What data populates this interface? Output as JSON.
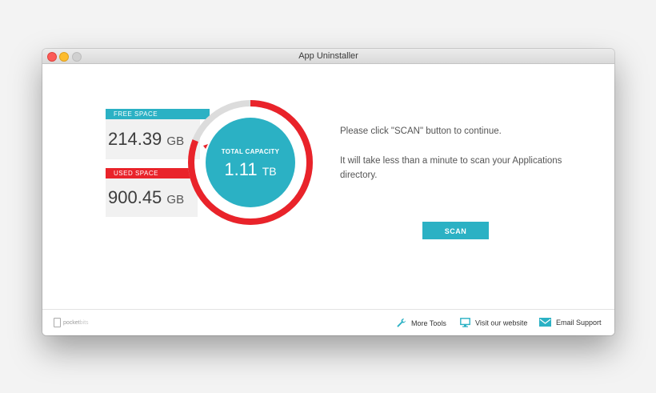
{
  "window": {
    "title": "App Uninstaller"
  },
  "disk": {
    "free_label": "FREE SPACE",
    "free_value": "214.39",
    "free_unit": "GB",
    "used_label": "USED SPACE",
    "used_value": "900.45",
    "used_unit": "GB",
    "capacity_label": "TOTAL CAPACITY",
    "capacity_value": "1.11",
    "capacity_unit": "TB",
    "free_fraction": 0.19,
    "used_fraction": 0.81
  },
  "main": {
    "message_primary": "Please click \"SCAN\" button to continue.",
    "message_secondary": "It will take less than a minute to scan your Applications directory.",
    "scan_label": "SCAN"
  },
  "footer": {
    "brand_part1": "pocket",
    "brand_part2": "bits",
    "more_tools": "More Tools",
    "visit_website": "Visit our website",
    "email_support": "Email Support"
  },
  "colors": {
    "accent_teal": "#2bb1c4",
    "accent_red": "#e9232a",
    "ring_gray": "#dcdcdc"
  },
  "icons": {
    "more_tools": "wrench-icon",
    "visit_website": "monitor-icon",
    "email_support": "envelope-icon"
  }
}
